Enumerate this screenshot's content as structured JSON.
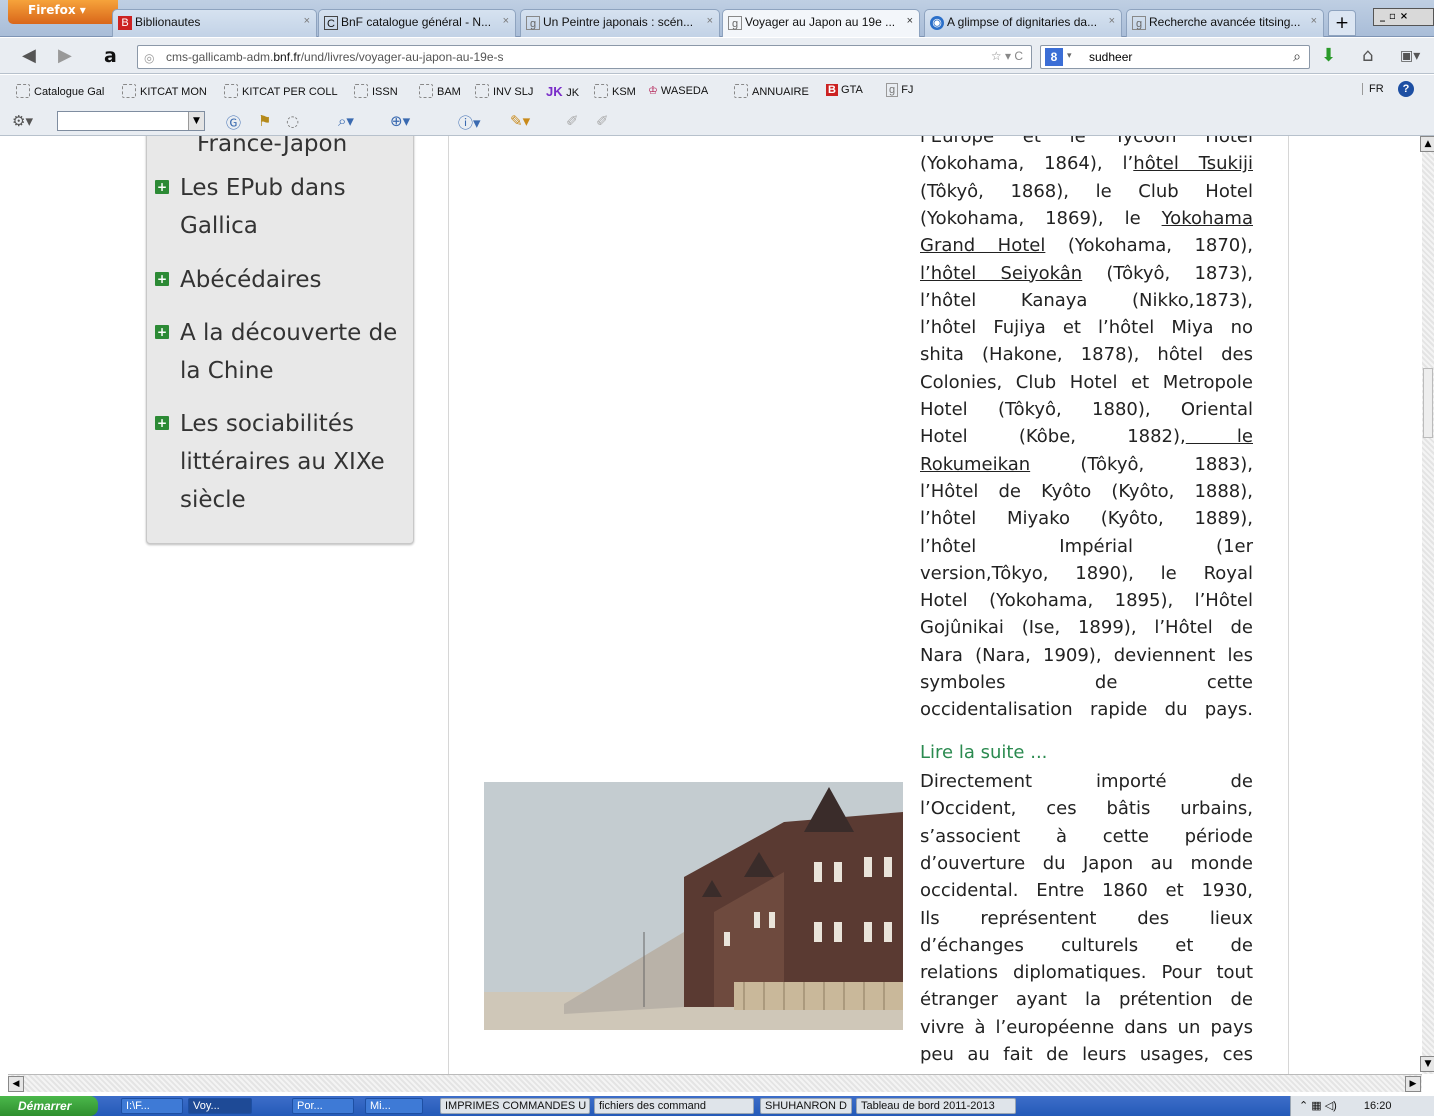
{
  "browser": {
    "firefox_label": "Firefox",
    "tabs": [
      {
        "label": "Biblionautes",
        "icon": "bookmark-icon"
      },
      {
        "label": "BnF catalogue général - N...",
        "icon": "catalogue-icon"
      },
      {
        "label": "Un Peintre japonais : scén...",
        "icon": "gallica-icon"
      },
      {
        "label": "Voyager au Japon au 19e ...",
        "icon": "gallica-icon"
      },
      {
        "label": "A glimpse of dignitaries da...",
        "icon": "world-icon"
      },
      {
        "label": "Recherche avancée titsing...",
        "icon": "gallica-icon"
      }
    ],
    "url_prefix": "cms-gallicamb-adm.",
    "url_domain": "bnf.fr",
    "url_path": "/und/livres/voyager-au-japon-au-19e-s",
    "search_value": "sudheer",
    "bookmarks": [
      "Catalogue Gal",
      "KITCAT MON",
      "KITCAT PER COLL",
      "ISSN",
      "BAM",
      "INV SLJ",
      "JK",
      "KSM",
      "WASEDA",
      "ANNUAIRE",
      "GTA",
      "FJ"
    ],
    "lang_button": "FR"
  },
  "sidebar": {
    "items": [
      {
        "label": "France-Japon"
      },
      {
        "label": "Les EPub dans Gallica"
      },
      {
        "label": "Abécédaires"
      },
      {
        "label": "A la découverte de la Chine"
      },
      {
        "label": "Les sociabilités littéraires au XIXe siècle"
      }
    ]
  },
  "article": {
    "lines1": [
      "l’Europe et le Tycoon Hotel",
      "(Yokohama, 1864), l’|hôtel Tsukiji|",
      "(Tôkyô, 1868), le Club Hotel",
      "(Yokohama, 1869), le |Yokohama|",
      "|Grand Hotel| (Yokohama, 1870),",
      "|l’hôtel Seiyokân| (Tôkyô, 1873),",
      "l’hôtel Kanaya (Nikko,1873),",
      "l’hôtel Fujiya et l’hôtel Miya no",
      "shita (Hakone, 1878), hôtel des",
      "Colonies, Club Hotel et Metropole",
      "Hotel (Tôkyô, 1880), Oriental",
      "Hotel (Kôbe, 1882),| le|",
      "|Rokumeikan| (Tôkyô, 1883),",
      "l’Hôtel de Kyôto (Kyôto, 1888),",
      "l’hôtel Miyako (Kyôto, 1889),",
      "l’hôtel Impérial (1er",
      "version,Tôkyo, 1890), le Royal",
      "Hotel (Yokohama, 1895), l’Hôtel",
      "Gojûnikai (Ise, 1899), l’Hôtel de",
      "Nara (Nara, 1909), deviennent les",
      "symboles de cette",
      "occidentalisation rapide du pays."
    ],
    "read_more": "Lire la suite ...",
    "lines2": [
      "Directement importé de",
      "l’Occident, ces bâtis urbains,",
      "s’associent à cette période",
      "d’ouverture du Japon au monde",
      "occidental. Entre 1860 et 1930,",
      " Ils représentent des lieux",
      "d’échanges culturels et de",
      "relations diplomatiques. Pour tout",
      "étranger ayant la prétention de",
      "vivre à l’européenne dans un pays",
      "peu au fait de leurs usages, ces"
    ]
  },
  "taskbar": {
    "start": "Démarrer",
    "items": [
      "I:\\F...",
      "Voy...",
      "Por...",
      "Mi...",
      "IMPRIMES COMMANDES U",
      "fichiers des command",
      "SHUHANRON D",
      "Tableau de bord 2011-2013"
    ],
    "clock": "16:20"
  },
  "colors": {
    "link_green": "#2a8a4f",
    "plus_green": "#2c8a35",
    "sidebar_bg": "#e8e8e8"
  }
}
